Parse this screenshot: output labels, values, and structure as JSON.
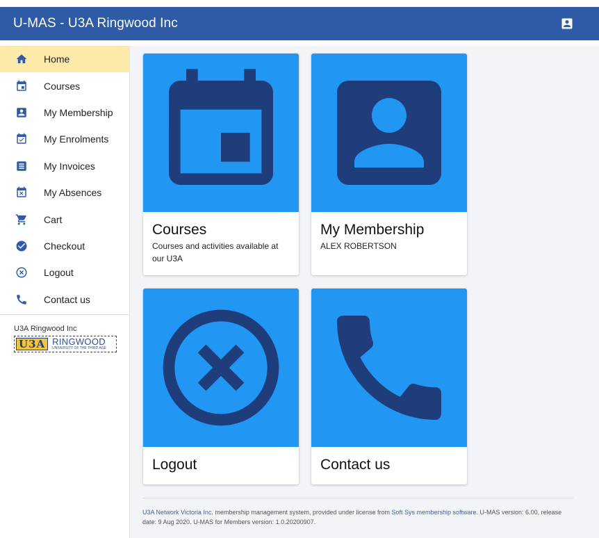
{
  "app": {
    "title": "U-MAS - U3A Ringwood Inc"
  },
  "header": {
    "account_icon": "account-box-icon"
  },
  "sidebar": {
    "items": [
      {
        "label": "Home",
        "icon": "home-icon",
        "active": true
      },
      {
        "label": "Courses",
        "icon": "calendar-icon"
      },
      {
        "label": "My Membership",
        "icon": "account-box-icon"
      },
      {
        "label": "My Enrolments",
        "icon": "event-available-icon"
      },
      {
        "label": "My Invoices",
        "icon": "receipt-icon"
      },
      {
        "label": "My Absences",
        "icon": "event-busy-icon"
      },
      {
        "label": "Cart",
        "icon": "cart-icon"
      },
      {
        "label": "Checkout",
        "icon": "check-circle-icon"
      },
      {
        "label": "Logout",
        "icon": "cancel-circle-icon"
      },
      {
        "label": "Contact us",
        "icon": "phone-icon"
      }
    ],
    "org_name": "U3A Ringwood Inc",
    "logo": {
      "badge": "U3A",
      "name": "RINGWOOD",
      "tagline": "UNIVERSITY OF THE THIRD AGE"
    }
  },
  "cards": [
    {
      "title": "Courses",
      "description": "Courses and activities available at our U3A",
      "icon": "calendar-icon"
    },
    {
      "title": "My Membership",
      "description": "ALEX ROBERTSON",
      "icon": "account-box-icon"
    },
    {
      "title": "Logout",
      "description": "",
      "icon": "cancel-circle-icon"
    },
    {
      "title": "Contact us",
      "description": "",
      "icon": "phone-icon"
    }
  ],
  "footer": {
    "link1": "U3A Network Victoria Inc",
    "text1": ". membership management system, provided under license from ",
    "link2": "Soft Sys membership software",
    "text2": ". U-MAS version: 6.00, release date: 9 Aug 2020. U-MAS for Members version: 1.0.20200907."
  },
  "colors": {
    "header": "#2e5aa6",
    "active_nav": "#fde9a8",
    "card_media": "#2196f3",
    "icon_dark": "#1f3d7a",
    "nav_icon": "#2e5aa6"
  }
}
